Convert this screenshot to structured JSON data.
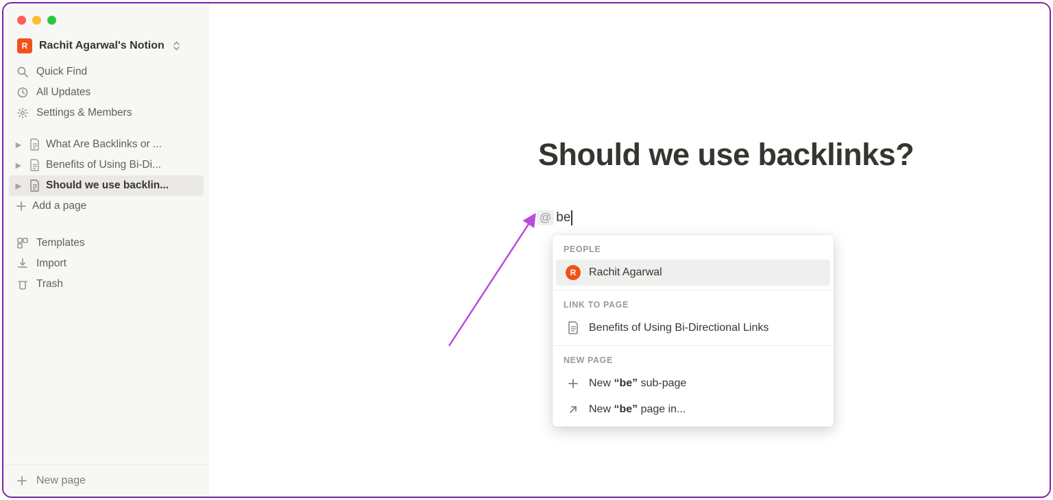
{
  "workspace": {
    "badge_letter": "R",
    "name": "Rachit Agarwal's Notion"
  },
  "sidebar": {
    "quick_find": "Quick Find",
    "all_updates": "All Updates",
    "settings": "Settings & Members",
    "pages": [
      {
        "label": "What Are Backlinks or ..."
      },
      {
        "label": "Benefits of Using Bi-Di..."
      },
      {
        "label": "Should we use backlin..."
      }
    ],
    "add_page": "Add a page",
    "templates": "Templates",
    "import": "Import",
    "trash": "Trash",
    "new_page": "New page"
  },
  "page": {
    "title": "Should we use backlinks?",
    "mention_prefix": "@",
    "mention_query": "be"
  },
  "popup": {
    "people_label": "PEOPLE",
    "person_name": "Rachit Agarwal",
    "person_initial": "R",
    "link_label": "LINK TO PAGE",
    "link_page": "Benefits of Using Bi-Directional Links",
    "new_page_label": "NEW PAGE",
    "new_sub_prefix": "New ",
    "new_sub_quoted": "“be”",
    "new_sub_suffix": " sub-page",
    "new_in_prefix": "New ",
    "new_in_quoted": "“be”",
    "new_in_suffix": " page in..."
  }
}
